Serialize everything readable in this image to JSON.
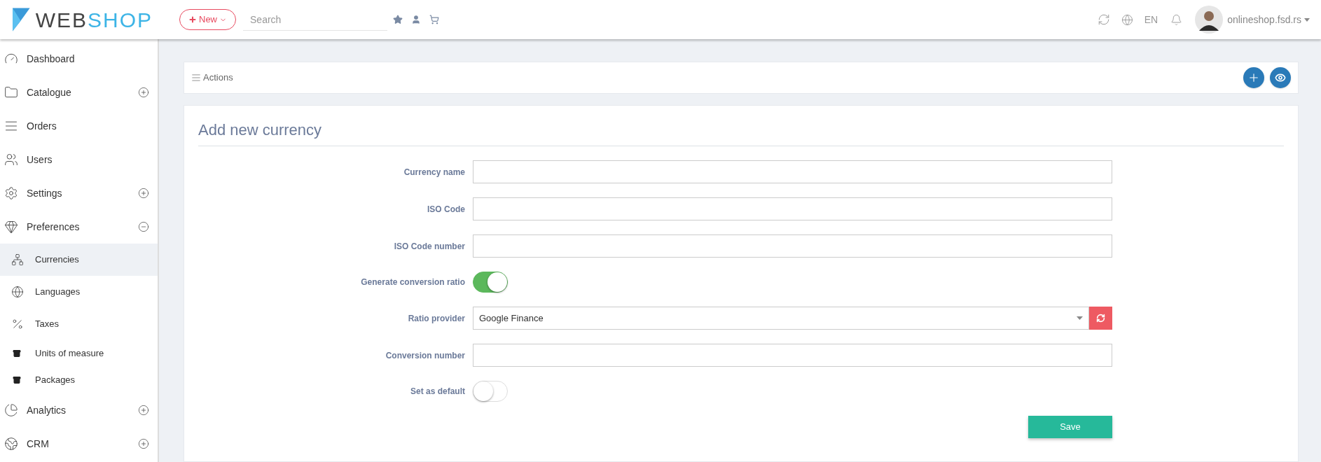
{
  "header": {
    "logo": {
      "part_1": "WEB",
      "part_2": "SHOP"
    },
    "new_button": "New",
    "search": {
      "placeholder": "Search"
    },
    "language": "EN",
    "user": "onlineshop.fsd.rs"
  },
  "sidebar": {
    "items": [
      {
        "label": "Dashboard",
        "selected": false
      },
      {
        "label": "Catalogue",
        "selected": false,
        "expanded": false
      },
      {
        "label": "Orders",
        "selected": false
      },
      {
        "label": "Users",
        "selected": false
      },
      {
        "label": "Settings",
        "selected": false,
        "expanded": false
      },
      {
        "label": "Preferences",
        "selected": false,
        "expanded": true,
        "children": [
          {
            "label": "Currencies",
            "selected": true
          },
          {
            "label": "Languages",
            "selected": false
          },
          {
            "label": "Taxes",
            "selected": false
          },
          {
            "label": "Units of measure",
            "selected": false
          },
          {
            "label": "Packages",
            "selected": false
          }
        ]
      },
      {
        "label": "Analytics",
        "selected": false,
        "expanded": false
      },
      {
        "label": "CRM",
        "selected": false,
        "expanded": false
      }
    ]
  },
  "actions": {
    "label": "Actions"
  },
  "form": {
    "title": "Add new currency",
    "fields": [
      {
        "label": "Currency name",
        "kind": "text"
      },
      {
        "label": "ISO Code",
        "kind": "text"
      },
      {
        "label": "ISO Code number",
        "kind": "text"
      },
      {
        "label": "Generate conversion ratio",
        "kind": "switch",
        "on": true
      },
      {
        "label": "Ratio provider",
        "kind": "select",
        "value": "Google Finance"
      },
      {
        "label": "Conversion number",
        "kind": "text"
      },
      {
        "label": "Set as default",
        "kind": "switch",
        "on": false
      }
    ],
    "submit": "Save"
  }
}
